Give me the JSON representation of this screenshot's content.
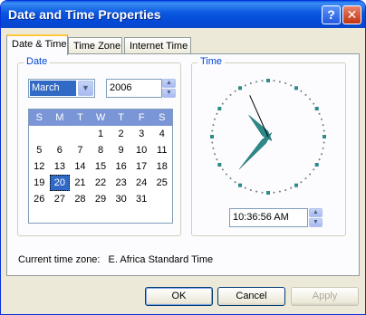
{
  "window": {
    "title": "Date and Time Properties",
    "help_glyph": "?",
    "close_glyph": "✕"
  },
  "tabs": [
    {
      "label": "Date & Time"
    },
    {
      "label": "Time Zone"
    },
    {
      "label": "Internet Time"
    }
  ],
  "date_group": {
    "label": "Date",
    "month": {
      "value": "March"
    },
    "year": {
      "value": "2006"
    }
  },
  "calendar": {
    "weekdays": [
      "S",
      "M",
      "T",
      "W",
      "T",
      "F",
      "S"
    ],
    "weeks": [
      [
        "",
        "",
        "",
        "1",
        "2",
        "3",
        "4"
      ],
      [
        "5",
        "6",
        "7",
        "8",
        "9",
        "10",
        "11"
      ],
      [
        "12",
        "13",
        "14",
        "15",
        "16",
        "17",
        "18"
      ],
      [
        "19",
        "20",
        "21",
        "22",
        "23",
        "24",
        "25"
      ],
      [
        "26",
        "27",
        "28",
        "29",
        "30",
        "31",
        ""
      ]
    ],
    "selected_day": "20",
    "header_color": "#7b96d6",
    "selected_color": "#316ac5"
  },
  "time_group": {
    "label": "Time",
    "time_value": "10:36:56 AM",
    "clock": {
      "hour": 10,
      "minute": 36,
      "second": 56
    }
  },
  "timezone": {
    "label": "Current time zone:",
    "name": "E. Africa Standard Time"
  },
  "buttons": {
    "ok": "OK",
    "cancel": "Cancel",
    "apply": "Apply"
  }
}
